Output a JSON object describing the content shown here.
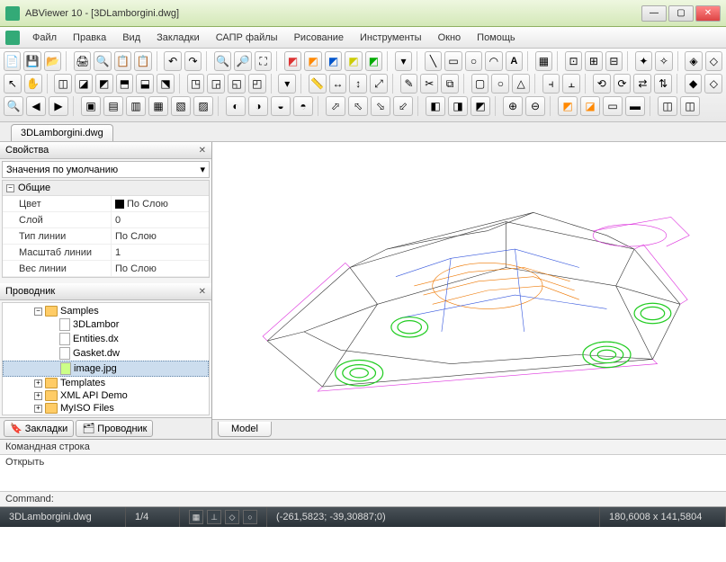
{
  "window": {
    "title": "ABViewer 10 - [3DLamborgini.dwg]"
  },
  "menu": {
    "items": [
      "Файл",
      "Правка",
      "Вид",
      "Закладки",
      "САПР файлы",
      "Рисование",
      "Инструменты",
      "Окно",
      "Помощь"
    ]
  },
  "file_tab": "3DLamborgini.dwg",
  "sidebar": {
    "properties_title": "Свойства",
    "defaults_dropdown": "Значения по умолчанию",
    "section_general": "Общие",
    "props": {
      "color_k": "Цвет",
      "color_v": "По Слою",
      "layer_k": "Слой",
      "layer_v": "0",
      "linetype_k": "Тип линии",
      "linetype_v": "По Слою",
      "linescale_k": "Масштаб линии",
      "linescale_v": "1",
      "lineweight_k": "Вес линии",
      "lineweight_v": "По Слою"
    },
    "explorer_title": "Проводник",
    "tree": {
      "samples": "Samples",
      "file1": "3DLambor",
      "file2": "Entities.dx",
      "file3": "Gasket.dw",
      "file4": "image.jpg",
      "templates": "Templates",
      "xmlapi": "XML API Demo",
      "myiso": "MyISO Files"
    },
    "tabs": {
      "bookmarks": "Закладки",
      "explorer": "Проводник"
    }
  },
  "viewport": {
    "model_tab": "Model"
  },
  "command": {
    "label": "Командная строка",
    "body": "Открыть",
    "prompt": "Command:"
  },
  "status": {
    "file": "3DLamborgini.dwg",
    "page": "1/4",
    "coords": "(-261,5823; -39,30887;0)",
    "dims": "180,6008 x 141,5804"
  }
}
